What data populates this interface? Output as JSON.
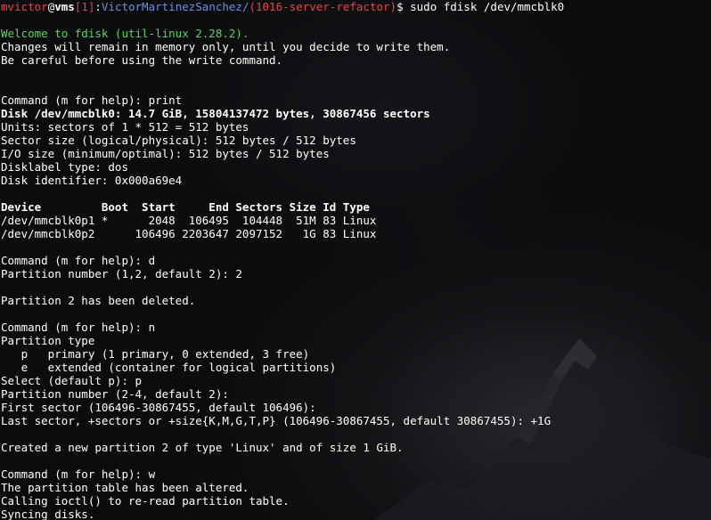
{
  "terminal": {
    "prompt": {
      "user": "mvictor",
      "at": "@",
      "host": "vms",
      "job": "[1]",
      "colon": ":",
      "path": "VictorMartinezSanchez/",
      "branch": "(1016-server-refactor)",
      "symbol": "$",
      "command": " sudo fdisk /dev/mmcblk0"
    },
    "lines": [
      {
        "text": "Welcome to fdisk (util-linux 2.28.2).",
        "style": "green"
      },
      {
        "text": "Changes will remain in memory only, until you decide to write them.",
        "style": "white"
      },
      {
        "text": "Be careful before using the write command.",
        "style": "white"
      },
      {
        "text": "",
        "style": "white"
      },
      {
        "text": "",
        "style": "white"
      },
      {
        "text": "Command (m for help): print",
        "style": "white"
      },
      {
        "text": "Disk /dev/mmcblk0: 14.7 GiB, 15804137472 bytes, 30867456 sectors",
        "style": "bold"
      },
      {
        "text": "Units: sectors of 1 * 512 = 512 bytes",
        "style": "white"
      },
      {
        "text": "Sector size (logical/physical): 512 bytes / 512 bytes",
        "style": "white"
      },
      {
        "text": "I/O size (minimum/optimal): 512 bytes / 512 bytes",
        "style": "white"
      },
      {
        "text": "Disklabel type: dos",
        "style": "white"
      },
      {
        "text": "Disk identifier: 0x000a69e4",
        "style": "white"
      },
      {
        "text": "",
        "style": "white"
      },
      {
        "text": "Device         Boot  Start     End Sectors Size Id Type",
        "style": "bold"
      },
      {
        "text": "/dev/mmcblk0p1 *      2048  106495  104448  51M 83 Linux",
        "style": "white"
      },
      {
        "text": "/dev/mmcblk0p2      106496 2203647 2097152   1G 83 Linux",
        "style": "white"
      },
      {
        "text": "",
        "style": "white"
      },
      {
        "text": "Command (m for help): d",
        "style": "white"
      },
      {
        "text": "Partition number (1,2, default 2): 2",
        "style": "white"
      },
      {
        "text": "",
        "style": "white"
      },
      {
        "text": "Partition 2 has been deleted.",
        "style": "white"
      },
      {
        "text": "",
        "style": "white"
      },
      {
        "text": "Command (m for help): n",
        "style": "white"
      },
      {
        "text": "Partition type",
        "style": "white"
      },
      {
        "text": "   p   primary (1 primary, 0 extended, 3 free)",
        "style": "white"
      },
      {
        "text": "   e   extended (container for logical partitions)",
        "style": "white"
      },
      {
        "text": "Select (default p): p",
        "style": "white"
      },
      {
        "text": "Partition number (2-4, default 2):",
        "style": "white"
      },
      {
        "text": "First sector (106496-30867455, default 106496):",
        "style": "white"
      },
      {
        "text": "Last sector, +sectors or +size{K,M,G,T,P} (106496-30867455, default 30867455): +1G",
        "style": "white"
      },
      {
        "text": "",
        "style": "white"
      },
      {
        "text": "Created a new partition 2 of type 'Linux' and of size 1 GiB.",
        "style": "white"
      },
      {
        "text": "",
        "style": "white"
      },
      {
        "text": "Command (m for help): w",
        "style": "white"
      },
      {
        "text": "The partition table has been altered.",
        "style": "white"
      },
      {
        "text": "Calling ioctl() to re-read partition table.",
        "style": "white"
      },
      {
        "text": "Syncing disks.",
        "style": "white"
      }
    ],
    "colors": {
      "background": "#0b0c0e",
      "text": "#ffffff",
      "user": "#e64646",
      "host": "#ffffff",
      "path": "#6f8fe0",
      "branch": "#e64646",
      "welcome": "#5fd35f"
    }
  }
}
